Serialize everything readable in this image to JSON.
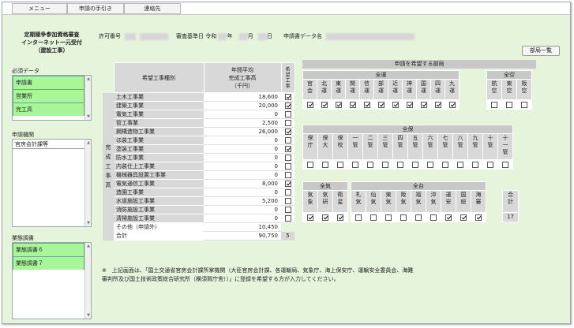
{
  "menu": [
    "メニュー",
    "申請の手引き",
    "連絡先"
  ],
  "header": {
    "title": "定期競争参加資格審査\nインターネット一元受付\n（建設工事）",
    "permit_label": "許可番号",
    "base_date_label": "審査基準日",
    "era": "令和",
    "year_unit": "年",
    "month_unit": "月",
    "day_unit": "日",
    "data_label": "申請書データ名"
  },
  "dept_button": "部局一覧",
  "required": {
    "label": "必須データ",
    "items": [
      "申請書",
      "営業所",
      "完工高"
    ]
  },
  "application_agency": {
    "label": "申請機関",
    "items": [
      "官房会計課等"
    ]
  },
  "survey": {
    "label": "業態調書",
    "items": [
      "業態調書６",
      "業態調書７"
    ]
  },
  "work_table": {
    "col_type": "希望工事種別",
    "col_avg": "年間平均\n完成工事高\n（千円）",
    "col_want": "希\n望\n工\n事",
    "side_label": "完\n成\n工\n事\n高",
    "rows": [
      {
        "name": "土木工事業",
        "value": "18,600",
        "checked": true
      },
      {
        "name": "建築工事業",
        "value": "20,000",
        "checked": true
      },
      {
        "name": "電気工事業",
        "value": "0",
        "checked": false
      },
      {
        "name": "管工事業",
        "value": "2,500",
        "checked": false
      },
      {
        "name": "鋼構造物工事業",
        "value": "26,000",
        "checked": true
      },
      {
        "name": "ほ装工事業",
        "value": "0",
        "checked": false
      },
      {
        "name": "塗装工事業",
        "value": "0",
        "checked": true
      },
      {
        "name": "防水工事業",
        "value": "0",
        "checked": false
      },
      {
        "name": "内装仕上工事業",
        "value": "0",
        "checked": false
      },
      {
        "name": "機械器具設置工事業",
        "value": "0",
        "checked": false
      },
      {
        "name": "電気通信工事業",
        "value": "8,000",
        "checked": true
      },
      {
        "name": "造園工事業",
        "value": "0",
        "checked": false
      },
      {
        "name": "水道施設工事業",
        "value": "5,200",
        "checked": false
      },
      {
        "name": "消防施設工事業",
        "value": "0",
        "checked": false
      },
      {
        "name": "清掃施設工事業",
        "value": "0",
        "checked": false
      }
    ],
    "other_label": "その他（申請外）",
    "other_value": "10,450",
    "total_label": "合計",
    "total_value": "90,750",
    "total_count": "5"
  },
  "dept_header": "申請を希望する部局",
  "zentei": {
    "label": "全運",
    "cols": [
      "官\n会",
      "北\n運",
      "東\n運",
      "関\n運",
      "信\n運",
      "部\n運",
      "近\n運",
      "神\n運",
      "国\n運",
      "四\n運",
      "九\n運"
    ],
    "checked": [
      true,
      true,
      true,
      true,
      true,
      true,
      true,
      true,
      true,
      true,
      true
    ]
  },
  "zenku": {
    "label": "全空",
    "cols": [
      "航\n空",
      "東\n空",
      "阪\n空"
    ],
    "checked": [
      false,
      false,
      false
    ]
  },
  "zenho": {
    "label": "全保",
    "cols": [
      "保\n庁",
      "保\n大",
      "保\n校",
      "一\n管",
      "二\n管",
      "三\n管",
      "四\n管",
      "五\n管",
      "六\n管",
      "七\n管",
      "八\n管",
      "九\n管",
      "十\n管",
      "十\n一\n管"
    ],
    "checked": [
      false,
      false,
      false,
      false,
      false,
      false,
      false,
      false,
      false,
      false,
      false,
      false,
      false,
      false
    ]
  },
  "zenki": {
    "label": "全気",
    "cols": [
      "気\n象",
      "気\n研",
      "衛\n星"
    ],
    "checked": [
      true,
      true,
      true
    ]
  },
  "zendai": {
    "label": "全台",
    "cols": [
      "札\n気",
      "仙\n気",
      "東\n気",
      "阪\n気",
      "福\n気",
      "沖\n気",
      "運\n安",
      "国\n総",
      "海\n審"
    ],
    "checked": [
      false,
      false,
      false,
      false,
      false,
      false,
      true,
      true,
      true
    ]
  },
  "sum": {
    "label": "合\n計",
    "value": "17"
  },
  "note": "※　上記画面は、「国土交通省官房会計課所掌機関（大臣官房会計課、各運輸局、気象庁、海上保安庁、運輸安全委員会、海難審判所及び国土技術政策総合研究所（横須賀庁舎））」に登録を希望する方が入力してください。"
}
